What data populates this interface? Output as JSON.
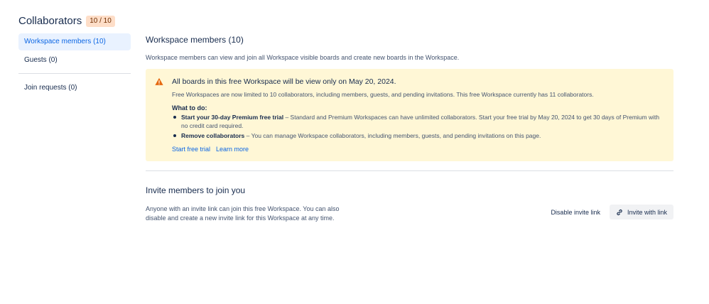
{
  "header": {
    "title": "Collaborators",
    "count_badge": "10 / 10"
  },
  "sidebar": {
    "items": [
      {
        "label": "Workspace members (10)",
        "active": true
      },
      {
        "label": "Guests (0)",
        "active": false
      },
      {
        "label": "Join requests (0)",
        "active": false
      }
    ]
  },
  "main": {
    "title": "Workspace members (10)",
    "description": "Workspace members can view and join all Workspace visible boards and create new boards in the Workspace.",
    "banner": {
      "icon": "warning-icon",
      "title": "All boards in this free Workspace will be view only on May 20, 2024.",
      "text": "Free Workspaces are now limited to 10 collaborators, including members, guests, and pending invitations. This free Workspace currently has 11 collaborators.",
      "todo_title": "What to do:",
      "todos": [
        {
          "bold": "Start your 30-day Premium free trial",
          "text": " – Standard and Premium Workspaces can have unlimited collaborators. Start your free trial by May 20, 2024 to get 30 days of Premium with no credit card required."
        },
        {
          "bold": "Remove collaborators",
          "text": " – You can manage Workspace collaborators, including members, guests, and pending invitations on this page."
        }
      ],
      "links": {
        "free_trial": "Start free trial",
        "learn_more": "Learn more"
      }
    },
    "invite": {
      "title": "Invite members to join you",
      "description": "Anyone with an invite link can join this free Workspace. You can also disable and create a new invite link for this Workspace at any time.",
      "disable_label": "Disable invite link",
      "invite_label": "Invite with link",
      "invite_icon": "link-icon"
    }
  },
  "colors": {
    "accent": "#0c66e4",
    "warning": "#e56910",
    "banner_bg": "#fff7d6",
    "badge_bg": "#fedec8"
  }
}
